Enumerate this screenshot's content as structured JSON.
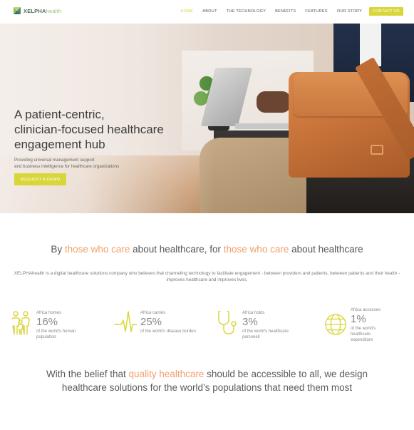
{
  "logo": {
    "brand_bold": "XELPHA",
    "brand_light": "health"
  },
  "nav": {
    "items": [
      {
        "label": "HOME",
        "active": true
      },
      {
        "label": "ABOUT"
      },
      {
        "label": "THE TECHNOLOGY"
      },
      {
        "label": "BENEFITS"
      },
      {
        "label": "FEATURES"
      },
      {
        "label": "OUR STORY"
      }
    ],
    "cta": "CONTACT US"
  },
  "hero": {
    "title_line1": "A patient-centric,",
    "title_line2": "clinician-focused healthcare",
    "title_line3": "engagement hub",
    "subtitle_line1": "Providing universal management support",
    "subtitle_line2": "and business intelligence for healthcare organizations",
    "button": "REQUEST A DEMO"
  },
  "about": {
    "title_part1": "By",
    "title_hl1": "those who care",
    "title_part2": "about healthcare, for",
    "title_hl2": "those who care",
    "title_part3": "about healthcare",
    "text": "XELPHAhealth is a digital healthcare solutions company who believes that channeling technology to facilitate engagement - between providers and patients, between patients and their health - improves healthcare and improves lives."
  },
  "stats": [
    {
      "icon": "family-icon",
      "lead": "Africa homes",
      "value": "16%",
      "desc": "of the world's human population"
    },
    {
      "icon": "heartbeat-icon",
      "lead": "Africa carries",
      "value": "25%",
      "desc": "of the world's disease burden"
    },
    {
      "icon": "stethoscope-icon",
      "lead": "Africa holds",
      "value": "3%",
      "desc": "of the world's healthcare personell"
    },
    {
      "icon": "globe-icon",
      "lead": "Africa accesses",
      "value": "1%",
      "desc": "of the world's healthcare expenditure"
    }
  ],
  "belief": {
    "part1": "With the belief that",
    "hl": "quality healthcare",
    "part2": "should be accessible to all, we design",
    "line2": "healthcare solutions for the world’s populations that need them most"
  },
  "colors": {
    "accent": "#d9d639",
    "highlight": "#f0a06a",
    "icon": "#d9d639"
  }
}
